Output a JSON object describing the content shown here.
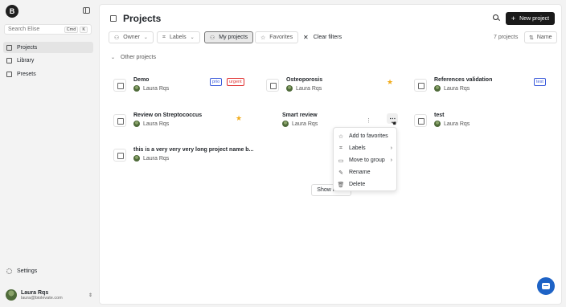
{
  "sidebar": {
    "logo_letter": "B",
    "search": {
      "placeholder": "Search Elise",
      "kbd1": "Cmd",
      "kbd2": "K"
    },
    "items": [
      {
        "label": "Projects",
        "active": true
      },
      {
        "label": "Library"
      },
      {
        "label": "Presets"
      }
    ],
    "settings_label": "Settings",
    "user": {
      "name": "Laura Rqs",
      "email": "laura@biolevate.com"
    }
  },
  "header": {
    "title": "Projects",
    "new_button_label": "New project"
  },
  "filters": {
    "owner": "Owner",
    "labels": "Labels",
    "my_projects": "My projects",
    "favorites": "Favorites",
    "clear": "Clear filters",
    "count": "7 projects",
    "sort": "Name"
  },
  "group": {
    "title": "Other projects"
  },
  "projects": [
    {
      "name": "Demo",
      "owner": "Laura Rqs",
      "badges": [
        {
          "text": "prio",
          "color": "#3b5bdb"
        },
        {
          "text": "urgent",
          "color": "#e03131"
        }
      ]
    },
    {
      "name": "Osteoporosis",
      "owner": "Laura Rqs",
      "favorite": true
    },
    {
      "name": "References validation",
      "owner": "Laura Rqs",
      "badges": [
        {
          "text": "test",
          "color": "#3b5bdb"
        }
      ]
    },
    {
      "name": "Review on Streptococcus",
      "owner": "Laura Rqs",
      "favorite": true
    },
    {
      "name": "Smart review",
      "owner": "Laura Rqs"
    },
    {
      "name": "test",
      "owner": "Laura Rqs"
    },
    {
      "name": "this is a very very very long project name b...",
      "owner": "Laura Rqs"
    }
  ],
  "show_more_label": "Show more",
  "context_menu": {
    "items": [
      {
        "label": "Add to favorites",
        "icon": "star-icon"
      },
      {
        "label": "Labels",
        "icon": "tag-icon",
        "submenu": true
      },
      {
        "label": "Move to group",
        "icon": "folder-icon",
        "submenu": true
      },
      {
        "label": "Rename",
        "icon": "pencil-icon"
      },
      {
        "label": "Delete",
        "icon": "trash-icon"
      }
    ]
  },
  "colors": {
    "accent_dark": "#1a1a1a",
    "favorite_star": "#f1ac1c",
    "chat_button": "#1e63c6"
  }
}
